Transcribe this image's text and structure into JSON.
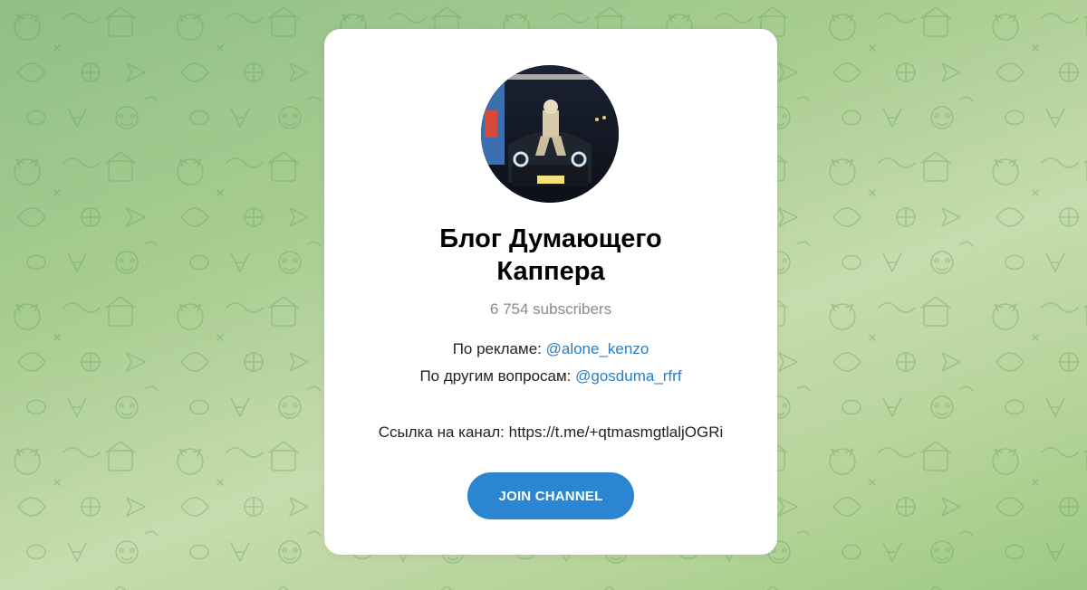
{
  "channel": {
    "title": "Блог Думающего\nКаппера",
    "subscribers": "6 754 subscribers",
    "avatar_icon": "channel-avatar-photo"
  },
  "description": {
    "ads_label": "По рекламе: ",
    "ads_link": "@alone_kenzo",
    "other_label": "По другим вопросам: ",
    "other_link": "@gosduma_rfrf",
    "channel_link_text": "Ссылка на канал: https://t.me/+qtmasmgtlaljOGRi"
  },
  "join_button": {
    "label": "JOIN CHANNEL"
  },
  "colors": {
    "link": "#2a7ec4",
    "button": "#2a86d1",
    "muted": "#8a8a8a"
  }
}
